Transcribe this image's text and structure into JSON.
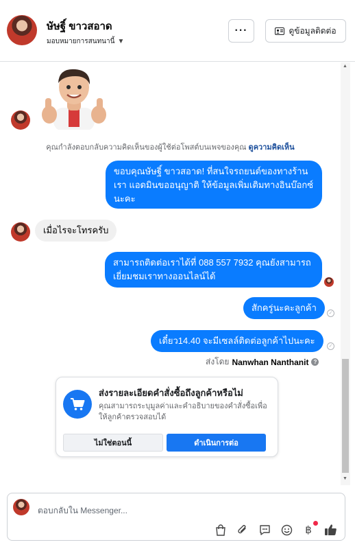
{
  "header": {
    "contact_name": "ษัษฐิ์ ขาวสอาด",
    "assign_label": "มอบหมายการสนทนานี้",
    "more_label": "···",
    "contact_info_label": "ดูข้อมูลติดต่อ"
  },
  "thread": {
    "reply_note_text": "คุณกำลังตอบกลับความคิดเห็นของผู้ใช้ต่อโพสต์บนเพจของคุณ",
    "reply_note_link": "ดูความคิดเห็น",
    "messages": [
      {
        "from": "page",
        "text": "ขอบคุณษัษฐิ์ ขาวสอาด! ที่สนใจรถยนต์ของทางร้านเรา แอดมินขออนุญาติ ให้ข้อมูลเพิ่มเติมทางอินบ๊อกซ์นะคะ"
      },
      {
        "from": "customer",
        "text": "เมื่อไรจะโทรครับ"
      },
      {
        "from": "page",
        "text": "สามารถติดต่อเราได้ที่ 088 557 7932 คุณยังสามารถเยี่ยมชมเราทางออนไลน์ได้"
      },
      {
        "from": "page",
        "text": "สักครู่นะคะลูกค้า"
      },
      {
        "from": "page",
        "text": "เดี๋ยว14.40 จะมีเซลล์ติดต่อลูกค้าไปนะคะ"
      }
    ],
    "sent_by_prefix": "ส่งโดย",
    "sent_by_name": "Nanwhan Nanthanit"
  },
  "order_card": {
    "title": "ส่งรายละเอียดคำสั่งซื้อถึงลูกค้าหรือไม่",
    "description": "คุณสามารถระบุมูลค่าและคำอธิบายของคำสั่งซื้อเพื่อให้ลูกค้าตรวจสอบได้",
    "dismiss_label": "ไม่ใช่ตอนนี้",
    "proceed_label": "ดำเนินการต่อ"
  },
  "composer": {
    "placeholder": "ตอบกลับใน Messenger...",
    "tools": [
      "shopping-bag-icon",
      "paperclip-icon",
      "saved-replies-icon",
      "emoji-icon",
      "baht-icon",
      "like-icon"
    ]
  },
  "colors": {
    "accent": "#0a7cff",
    "primary_button": "#1877f2",
    "incoming_bubble": "#f0f0f0",
    "notification": "#f02849"
  }
}
